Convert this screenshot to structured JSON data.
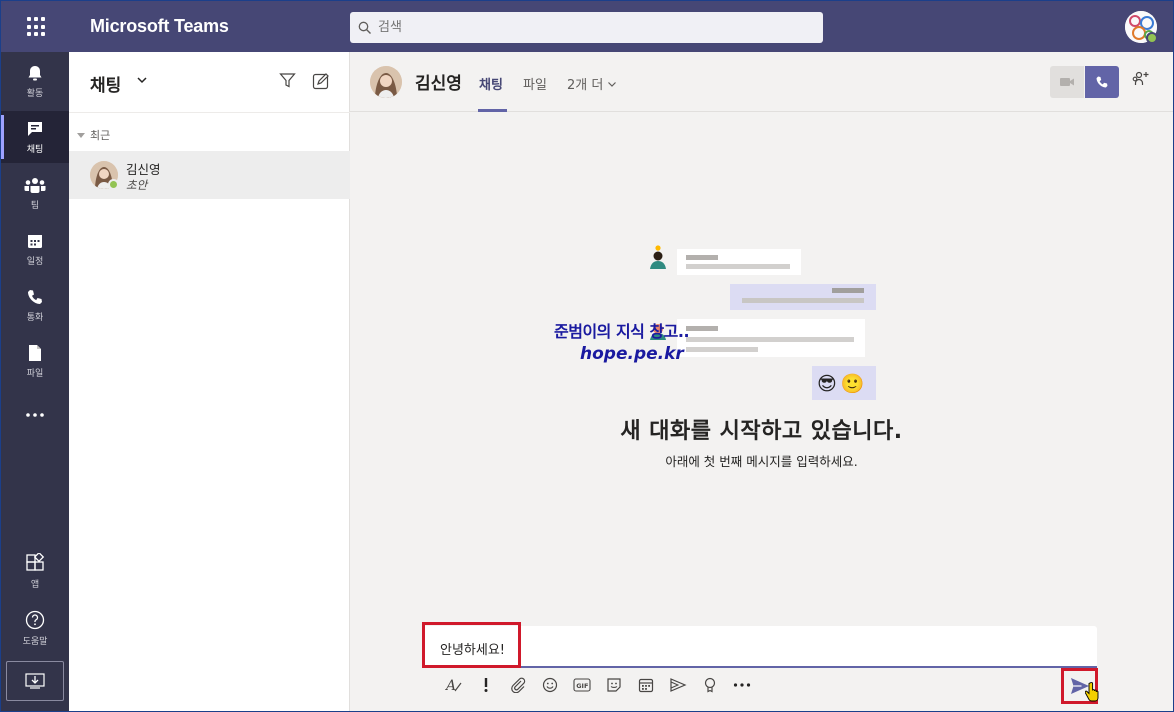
{
  "app": {
    "title": "Microsoft Teams"
  },
  "search": {
    "placeholder": "검색"
  },
  "rail": {
    "items": [
      {
        "id": "activity",
        "label": "활동",
        "icon": "bell-icon"
      },
      {
        "id": "chat",
        "label": "채팅",
        "icon": "chat-icon",
        "active": true
      },
      {
        "id": "teams",
        "label": "팀",
        "icon": "teams-icon"
      },
      {
        "id": "calendar",
        "label": "일정",
        "icon": "calendar-icon"
      },
      {
        "id": "calls",
        "label": "통화",
        "icon": "phone-icon"
      },
      {
        "id": "files",
        "label": "파일",
        "icon": "file-icon"
      },
      {
        "id": "more",
        "label": "",
        "icon": "more-icon"
      }
    ],
    "apps_label": "앱",
    "help_label": "도움말"
  },
  "chat_list": {
    "title": "채팅",
    "section": "최근",
    "items": [
      {
        "name": "김신영",
        "preview": "초안",
        "status": "available"
      }
    ]
  },
  "conversation": {
    "name": "김신영",
    "tabs": [
      "채팅",
      "파일",
      "2개 더"
    ],
    "active_tab": "채팅",
    "empty_title": "새 대화를 시작하고 있습니다.",
    "empty_subtitle": "아래에 첫 번째 메시지를 입력하세요.",
    "watermark_line1": "준범이의 지식 창고..",
    "watermark_line2": "hope.pe.kr",
    "illustration_emoji": "😎🙂"
  },
  "compose": {
    "text": "안녕하세요!",
    "toolbar": [
      "format-icon",
      "important-icon",
      "attach-icon",
      "emoji-icon",
      "gif-icon",
      "sticker-icon",
      "schedule-meeting-icon",
      "stream-icon",
      "praise-icon",
      "more-options-icon"
    ]
  },
  "colors": {
    "topbar": "#464775",
    "rail": "#33344a",
    "accent": "#6264a7",
    "highlight": "#d0192b",
    "status_available": "#92c353"
  }
}
